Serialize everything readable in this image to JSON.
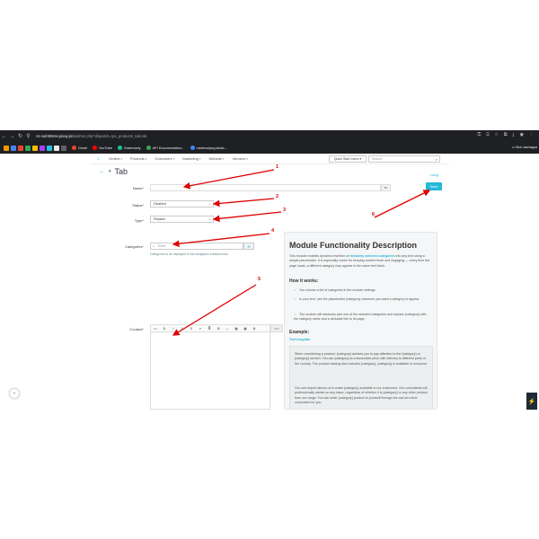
{
  "browser": {
    "url_host": "cs-cart455mv.pisay.pro",
    "url_path": "/admin.php?dispatch=rpx_products_tab.tab",
    "bookmarks": [
      {
        "label": "Gmail",
        "color": "#ea4335"
      },
      {
        "label": "YouTube",
        "color": "#ff0000"
      },
      {
        "label": "Grammarly",
        "color": "#15c39a"
      },
      {
        "label": "API Documentation...",
        "color": "#34a853"
      },
      {
        "label": "rusbesolpsy.pisola...",
        "color": "#4285f4"
      }
    ],
    "bookmarks_right": "Все закладки"
  },
  "nav": {
    "items": [
      "Orders",
      "Products",
      "Customers",
      "Marketing",
      "Website",
      "Vendors"
    ],
    "quick_menu": "Quick Start menu",
    "search_placeholder": "Search"
  },
  "page": {
    "title": "Tab",
    "lang_link": "Lang",
    "save": "Save"
  },
  "form": {
    "name_label": "Name",
    "name_lang": "en",
    "status_label": "Status",
    "status_value": "Disabled",
    "type_label": "Type",
    "type_value": "Replace",
    "categories_label": "Categories",
    "categories_placeholder": "Enter",
    "categories_help": "Categories to be displayed in the navigation breadcrumbs.",
    "content_label": "Content",
    "toolbar": [
      "<>",
      "B",
      "I",
      "U",
      "S",
      "≡",
      "≣",
      "⊞",
      "—",
      "▦",
      "▣",
      "⚙"
    ],
    "code_btn": "</>"
  },
  "panel": {
    "title": "Module Functionality Description",
    "intro_1": "This module enables dynamic insertion of",
    "intro_bold": "randomly selected categories",
    "intro_2": "into any text using a simple placeholder. It is especially useful for keeping content fresh and engaging — every time the page loads, a different category may appear in the same text block.",
    "how_title": "How it works:",
    "checks": [
      "You choose a list of categories in the module settings.",
      "In your text, use the placeholder {category} wherever you want a category to appear.",
      "The module will randomly pick one of the selected categories and replace {category} with the category name and a clickable link to its page."
    ],
    "example_title": "Example:",
    "example_link": "Text template:",
    "example_1": "When considering a product, {category} advises you to pay attention to the {category} or {category} section. You can {category} at a favourable price with delivery to different parts of the country. The product catalog also includes {category}, {category} is available to everyone.",
    "example_2": "Our own import allows us to make {category} available to our customers. Our consultants will professionally advise on any issue, regardless of whether it is {category} or any other product from our range. You can order {category} product to yourself through the cart at a time convenient for you."
  },
  "annotations": [
    "1",
    "2",
    "3",
    "4",
    "5",
    "6"
  ],
  "colors": {
    "accent": "#25b9d7",
    "annotation": "#e00000",
    "chrome": "#1f2023"
  }
}
